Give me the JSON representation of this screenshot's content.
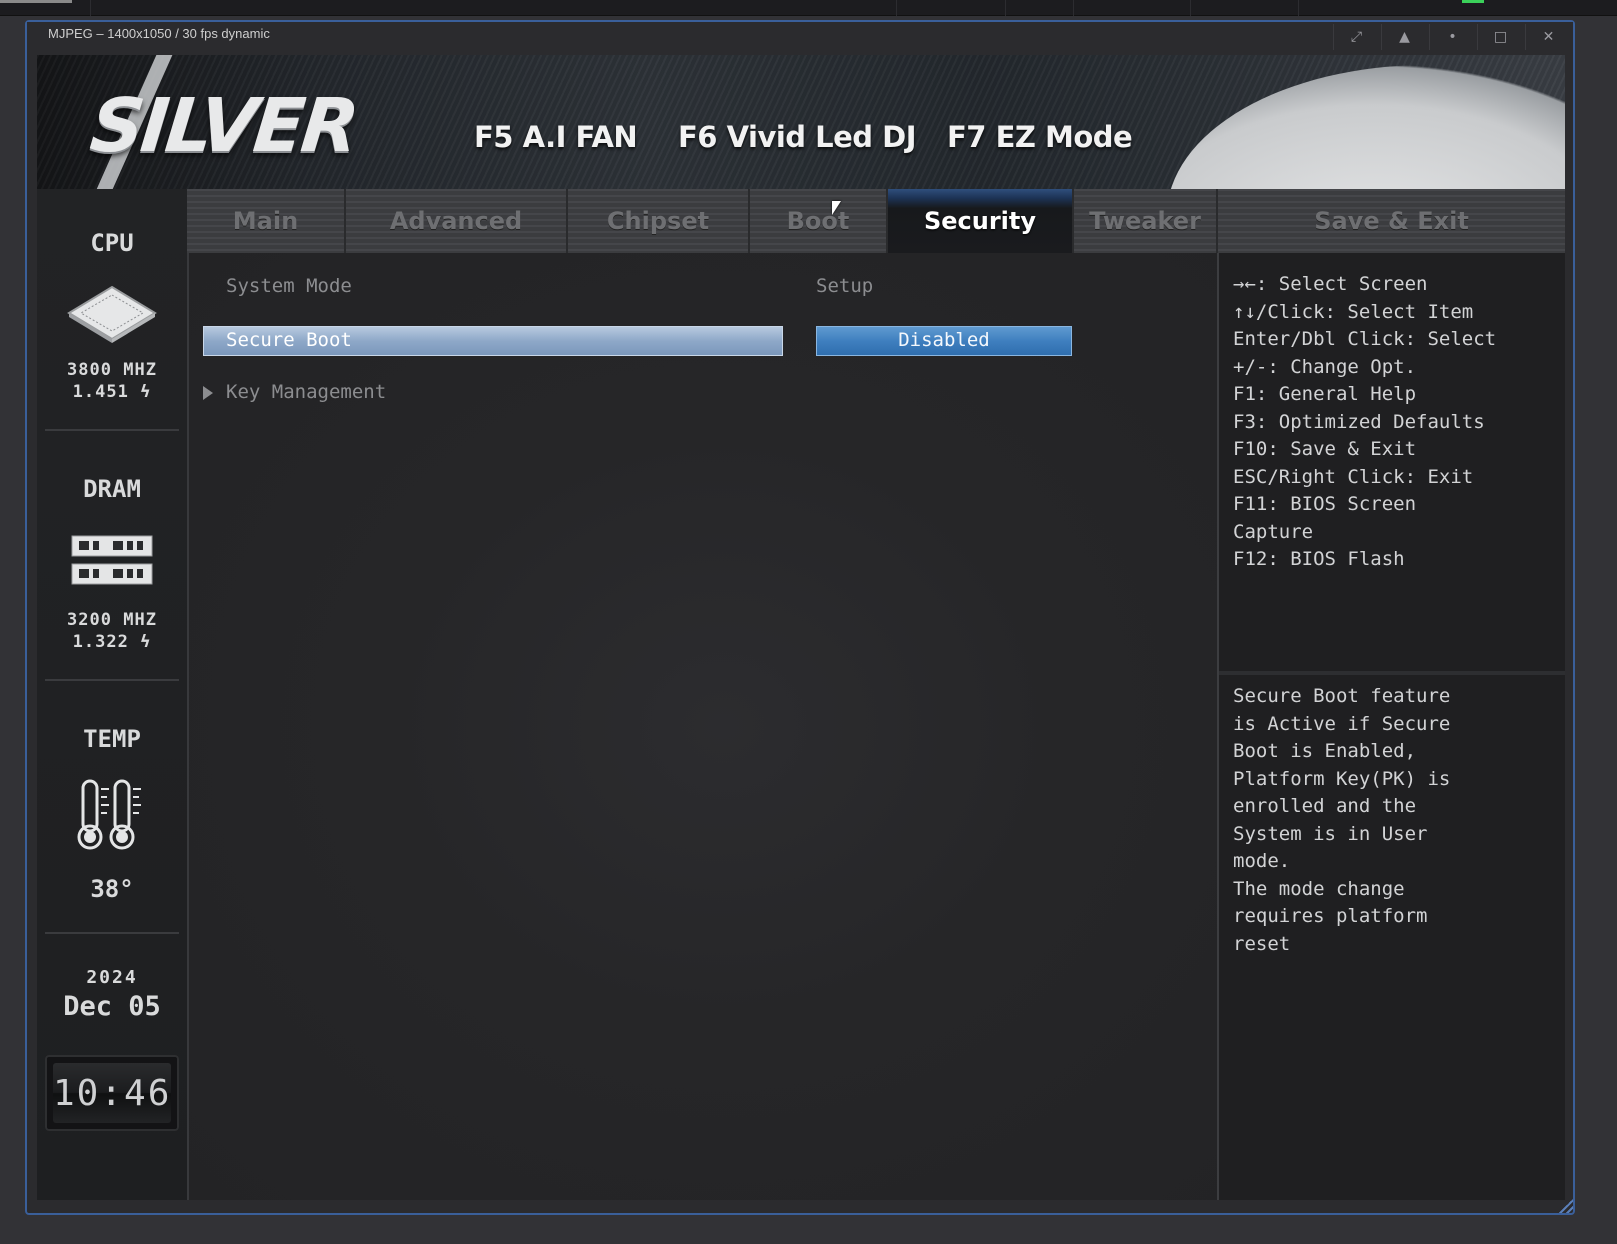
{
  "viewer": {
    "title": "MJPEG – 1400x1050 / 30 fps dynamic",
    "controls": [
      "⤢",
      "▲",
      "•",
      "□",
      "✕"
    ]
  },
  "header": {
    "logo": "SILVER",
    "shortcuts": [
      "F5 A.I FAN",
      "F6 Vivid Led DJ",
      "F7 EZ Mode"
    ]
  },
  "tabs": [
    {
      "label": "Main",
      "active": false
    },
    {
      "label": "Advanced",
      "active": false
    },
    {
      "label": "Chipset",
      "active": false
    },
    {
      "label": "Boot",
      "active": false
    },
    {
      "label": "Security",
      "active": true
    },
    {
      "label": "Tweaker",
      "active": false
    },
    {
      "label": "Save & Exit",
      "active": false
    }
  ],
  "status": {
    "cpu": {
      "label": "CPU",
      "freq": "3800 MHZ",
      "volt": "1.451 ϟ"
    },
    "dram": {
      "label": "DRAM",
      "freq": "3200 MHZ",
      "volt": "1.322 ϟ"
    },
    "temp": {
      "label": "TEMP",
      "value": "38°"
    },
    "date": {
      "year": "2024",
      "day": "Dec 05"
    },
    "time": "10:46"
  },
  "main": {
    "system_mode_label": "System Mode",
    "system_mode_value": "Setup",
    "secure_boot_label": "Secure Boot",
    "secure_boot_value": "Disabled",
    "key_management_label": "Key Management"
  },
  "help": {
    "keys": "→←: Select Screen\n↑↓/Click: Select Item\nEnter/Dbl Click: Select\n+/-: Change Opt.\nF1: General Help\nF3: Optimized Defaults\nF10: Save & Exit\nESC/Right Click: Exit\nF11: BIOS Screen\nCapture\nF12: BIOS Flash",
    "description": "Secure Boot feature\nis Active if Secure\nBoot is Enabled,\nPlatform Key(PK) is\nenrolled and the\nSystem is in User\nmode.\nThe mode change\nrequires platform\nreset"
  },
  "colors": {
    "accent": "#3f7fbf",
    "selection": "#8ea8c8",
    "active_tab": "#1d3356"
  }
}
